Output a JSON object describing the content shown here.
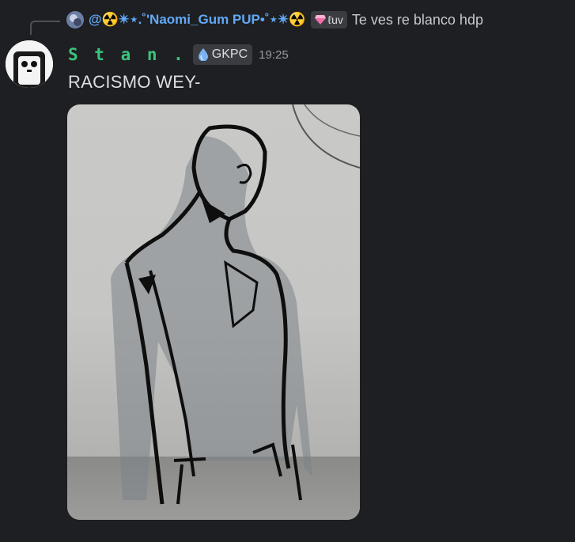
{
  "reply": {
    "author_prefix": "@",
    "author_name": "☢️✴︎⋆.˚'Naomi_Gum PUP•˚⋆✴︎☢️",
    "tag_icon": "gem-icon",
    "tag_label": "ℓuv",
    "text": "Te ves re blanco hdp"
  },
  "message": {
    "username": "S t a n .",
    "tag_icon": "water-drop-icon",
    "tag_label": "GKPC",
    "timestamp": "19:25",
    "content": "RACISMO WEY-",
    "attachment_icon": "image-attachment"
  },
  "colors": {
    "background": "#1e1f22",
    "username": "#3cc47a",
    "mention": "#61a9f7"
  }
}
